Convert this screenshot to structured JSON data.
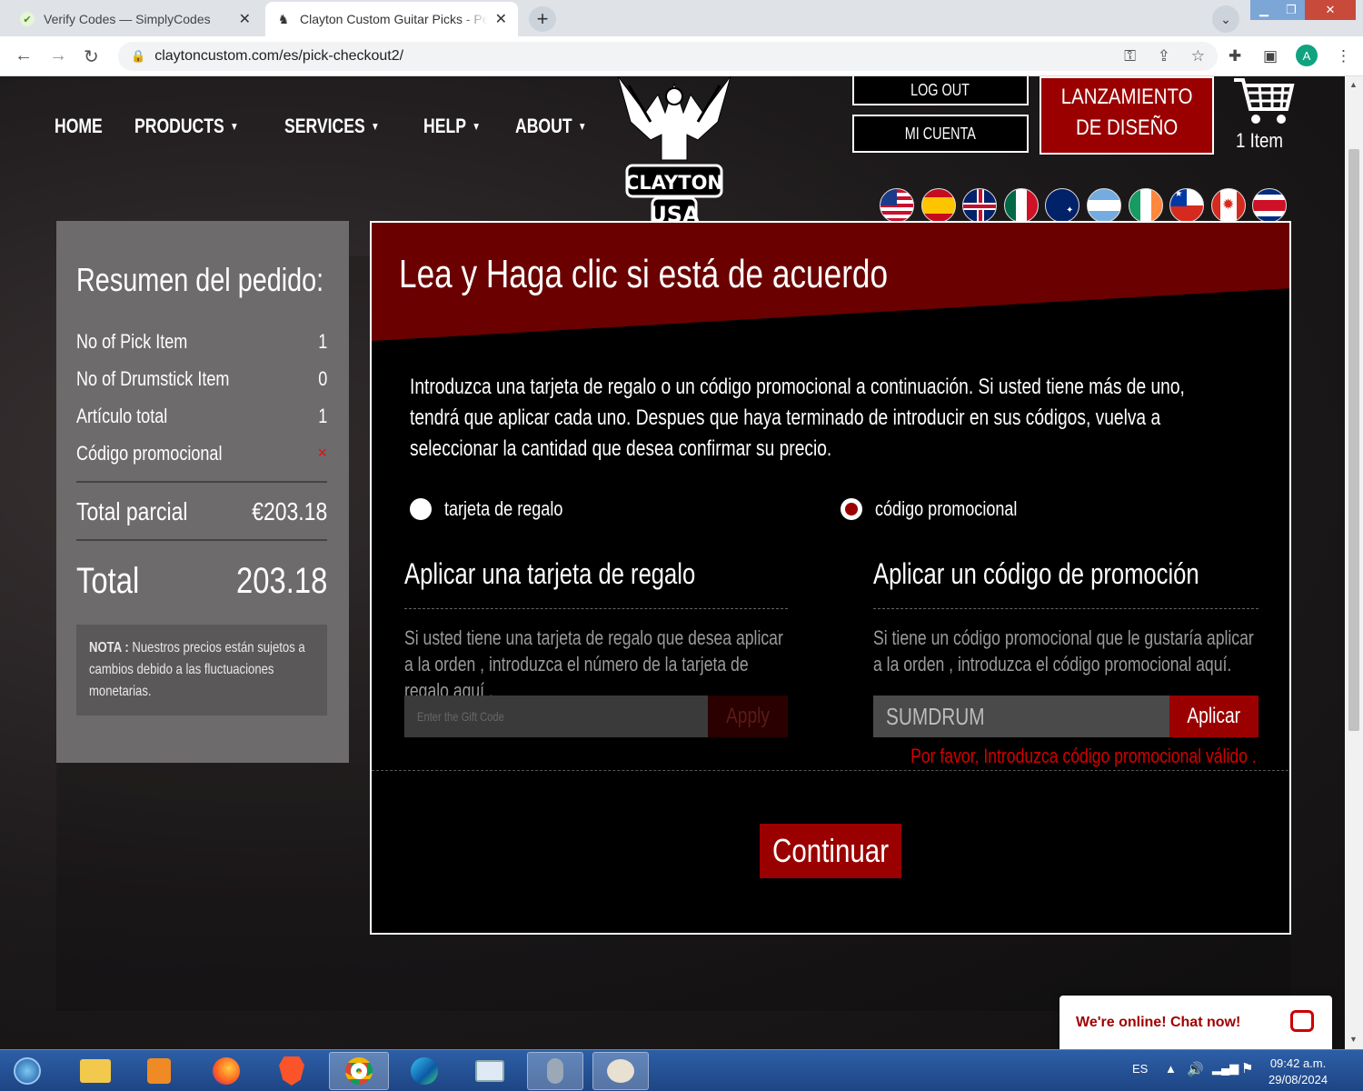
{
  "browser": {
    "tabs": [
      {
        "title": "Verify Codes — SimplyCodes",
        "active": false
      },
      {
        "title": "Clayton Custom Guitar Picks - Pe",
        "active": true
      }
    ],
    "url": "claytoncustom.com/es/pick-checkout2/",
    "profile_initial": "A"
  },
  "nav": {
    "items": [
      {
        "label": "HOME",
        "dropdown": false
      },
      {
        "label": "PRODUCTS",
        "dropdown": true
      },
      {
        "label": "SERVICES",
        "dropdown": true
      },
      {
        "label": "HELP",
        "dropdown": true
      },
      {
        "label": "ABOUT",
        "dropdown": true
      }
    ]
  },
  "logo": {
    "text": "CLAYTON",
    "sub": "USA"
  },
  "header": {
    "logout": "LOG OUT",
    "account": "MI CUENTA",
    "launch": "LANZAMIENTO\nDE DISEÑO",
    "cart_count": "1 Item"
  },
  "summary": {
    "title": "Resumen del pedido:",
    "rows": [
      {
        "label": "No of Pick Item",
        "value": "1"
      },
      {
        "label": "No of Drumstick Item",
        "value": "0"
      },
      {
        "label": "Artículo total",
        "value": "1"
      },
      {
        "label": "Código promocional",
        "value": "×"
      }
    ],
    "subtotal_label": "Total parcial",
    "subtotal_value": "€203.18",
    "total_label": "Total",
    "total_value": "203.18",
    "note_label": "NOTA :",
    "note_text": " Nuestros precios están sujetos a cambios debido a las fluctuaciones monetarias."
  },
  "panel": {
    "title": "Lea y Haga clic si está de acuerdo",
    "intro": "Introduzca una tarjeta de regalo o un código promocional a continuación. Si usted tiene más de uno, tendrá que aplicar cada uno. Despues que haya terminado de introducir en sus códigos, vuelva a seleccionar la cantidad que desea confirmar su precio.",
    "radio_gift": "tarjeta de regalo",
    "radio_promo": "código promocional",
    "gift_heading": "Aplicar una tarjeta de regalo",
    "gift_text": "Si usted tiene una tarjeta de regalo que desea aplicar a la orden , introduzca el número de la tarjeta de regalo aquí .",
    "gift_placeholder": "Enter the Gift Code",
    "gift_button": "Apply",
    "promo_heading": "Aplicar un código de promoción",
    "promo_text": "Si tiene un código promocional que le gustaría aplicar a la orden , introduzca el código promocional aquí.",
    "promo_value": "SUMDRUM",
    "promo_button": "Aplicar",
    "error": "Por favor, Introduzca código promocional válido .",
    "continue": "Continuar"
  },
  "chat": {
    "label": "We're online! Chat now!"
  },
  "taskbar": {
    "language": "ES",
    "time": "09:42 a.m.",
    "date": "29/08/2024"
  },
  "colors": {
    "accent": "#9a0000",
    "panel_bg": "#000000",
    "sidebar_bg": "#6e6b6c"
  }
}
